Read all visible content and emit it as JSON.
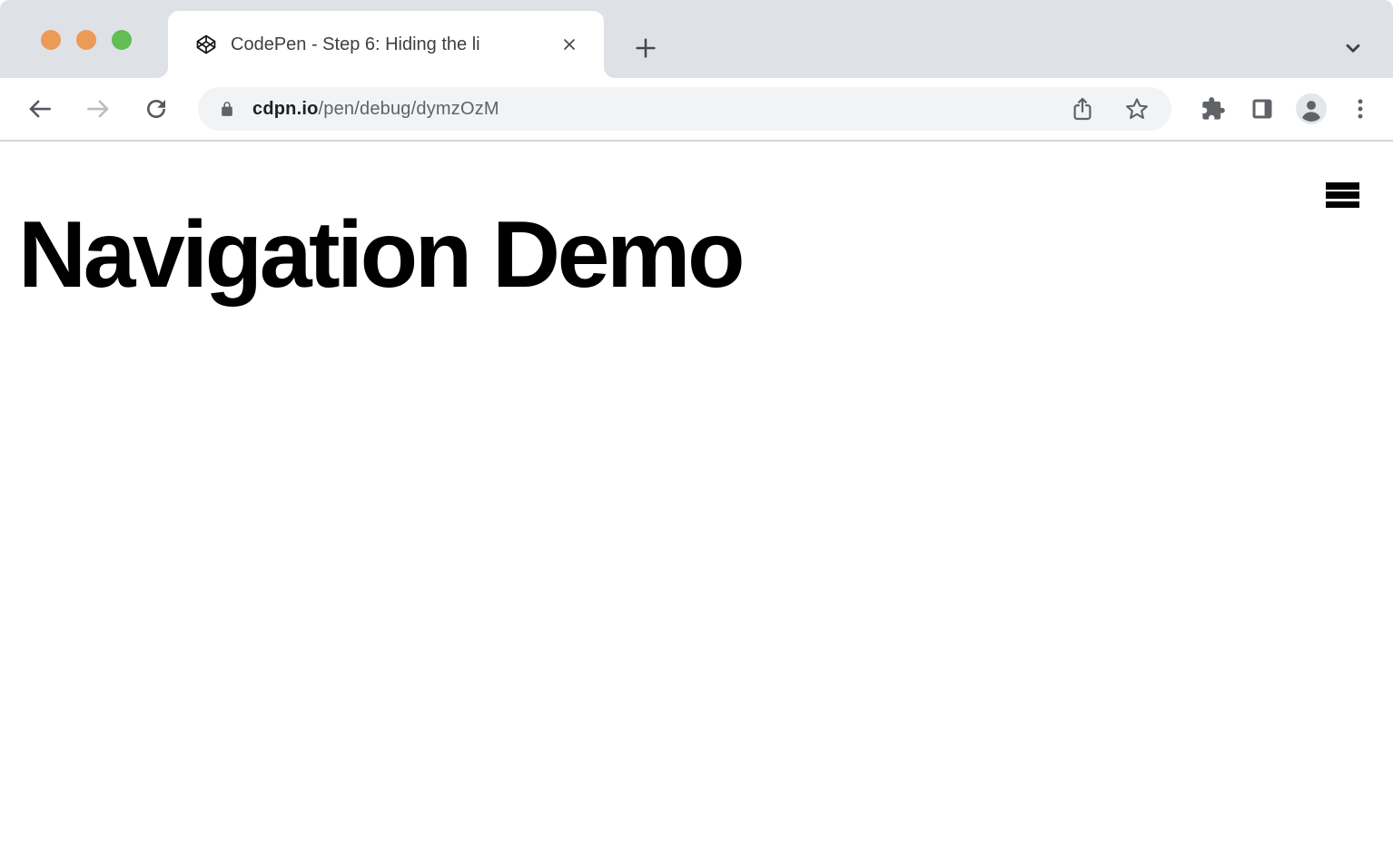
{
  "window": {
    "traffic_lights": [
      "#EC9A57",
      "#EC9A57",
      "#62BD54"
    ],
    "tab": {
      "favicon": "codepen-logo-icon",
      "title": "CodePen - Step 6: Hiding the li",
      "close_icon": "close-icon"
    },
    "new_tab_icon": "plus-icon",
    "tab_list_icon": "chevron-down-icon"
  },
  "toolbar": {
    "back_icon": "arrow-back-icon",
    "forward_icon": "arrow-forward-icon",
    "reload_icon": "reload-icon",
    "address_bar": {
      "lock_icon": "lock-icon",
      "domain": "cdpn.io",
      "path": "/pen/debug/dymzOzM",
      "share_icon": "share-icon",
      "bookmark_icon": "star-icon"
    },
    "extensions_icon": "puzzle-icon",
    "side_panel_icon": "side-panel-icon",
    "profile_icon": "avatar-icon",
    "menu_icon": "three-dot-menu-icon"
  },
  "page": {
    "heading": "Navigation Demo",
    "menu_icon": "hamburger-icon"
  },
  "colors": {
    "tab_strip_bg": "#dee1e6",
    "toolbar_bg": "#ffffff",
    "address_pill_bg": "#f1f3f4",
    "icon_gray": "#5f6368",
    "nav_icon_dark": "#54585e",
    "forward_disabled": "#b9bcc1",
    "url_domain": "#202124",
    "url_path": "#5f6368",
    "page_bg": "#ffffff",
    "heading_text": "#000000"
  }
}
